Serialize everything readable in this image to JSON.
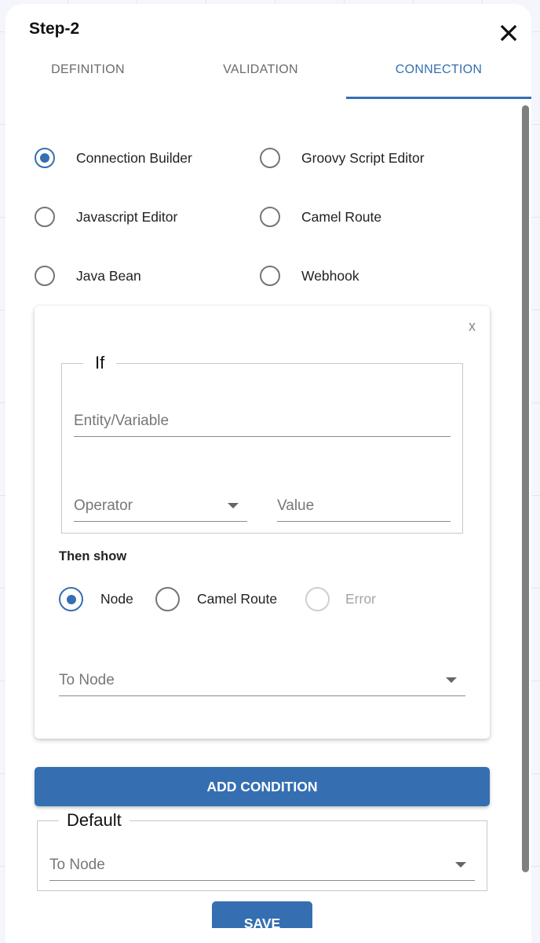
{
  "dialog": {
    "title": "Step-2",
    "close_icon": "close-icon"
  },
  "tabs": [
    {
      "label": "DEFINITION",
      "active": false
    },
    {
      "label": "VALIDATION",
      "active": false
    },
    {
      "label": "CONNECTION",
      "active": true
    }
  ],
  "connection_types": {
    "selected": "Connection Builder",
    "options": [
      {
        "label": "Connection Builder",
        "checked": true
      },
      {
        "label": "Groovy Script Editor",
        "checked": false
      },
      {
        "label": "Javascript Editor",
        "checked": false
      },
      {
        "label": "Camel Route",
        "checked": false
      },
      {
        "label": "Java Bean",
        "checked": false
      },
      {
        "label": "Webhook",
        "checked": false
      }
    ]
  },
  "condition_card": {
    "remove_label": "x",
    "if_legend": "If",
    "entity_placeholder": "Entity/Variable",
    "operator_placeholder": "Operator",
    "value_placeholder": "Value",
    "then_show_label": "Then show",
    "then_options": [
      {
        "label": "Node",
        "checked": true,
        "disabled": false
      },
      {
        "label": "Camel Route",
        "checked": false,
        "disabled": false
      },
      {
        "label": "Error",
        "checked": false,
        "disabled": true
      }
    ],
    "to_node_placeholder": "To Node"
  },
  "add_condition_label": "ADD CONDITION",
  "default_section": {
    "legend": "Default",
    "to_node_placeholder": "To Node"
  },
  "save_label": "SAVE",
  "colors": {
    "accent": "#356fb2",
    "radio_unchecked": "#757575",
    "radio_disabled": "#cfcfcf"
  }
}
